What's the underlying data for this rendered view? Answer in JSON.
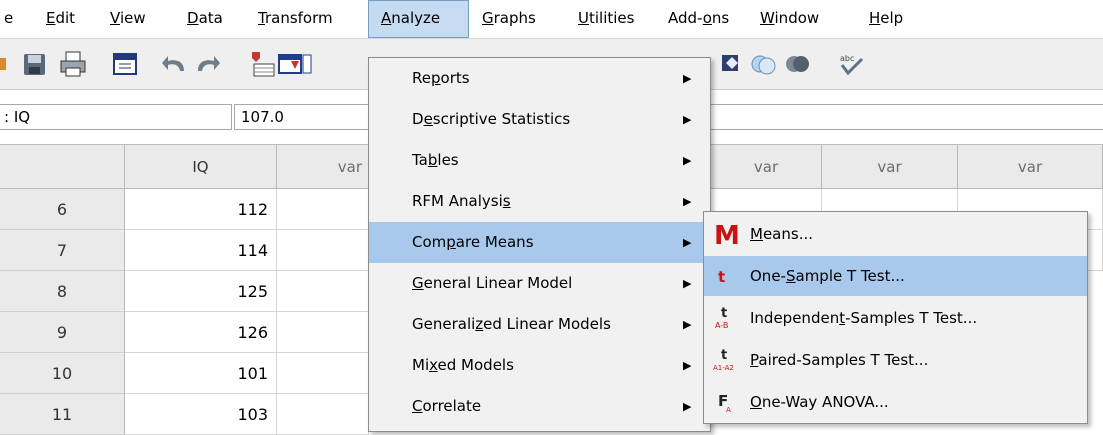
{
  "menubar": {
    "items": [
      {
        "id": "file",
        "pre": "",
        "ul": "",
        "post": "e"
      },
      {
        "id": "edit",
        "pre": "",
        "ul": "E",
        "post": "dit"
      },
      {
        "id": "view",
        "pre": "",
        "ul": "V",
        "post": "iew"
      },
      {
        "id": "data",
        "pre": "",
        "ul": "D",
        "post": "ata"
      },
      {
        "id": "transform",
        "pre": "",
        "ul": "T",
        "post": "ransform"
      },
      {
        "id": "analyze",
        "pre": "",
        "ul": "A",
        "post": "nalyze"
      },
      {
        "id": "graphs",
        "pre": "",
        "ul": "G",
        "post": "raphs"
      },
      {
        "id": "utilities",
        "pre": "",
        "ul": "U",
        "post": "tilities"
      },
      {
        "id": "addons",
        "pre": "Add-",
        "ul": "o",
        "post": "ns"
      },
      {
        "id": "window",
        "pre": "",
        "ul": "W",
        "post": "indow"
      },
      {
        "id": "help",
        "pre": "",
        "ul": "H",
        "post": "elp"
      }
    ]
  },
  "cellbar": {
    "cell_name": ": IQ",
    "cell_value": "107.0"
  },
  "grid": {
    "columns": [
      "IQ",
      "var",
      "var",
      "var",
      "var"
    ],
    "rows": [
      {
        "num": "6",
        "iq": "112"
      },
      {
        "num": "7",
        "iq": "114"
      },
      {
        "num": "8",
        "iq": "125"
      },
      {
        "num": "9",
        "iq": "126"
      },
      {
        "num": "10",
        "iq": "101"
      },
      {
        "num": "11",
        "iq": "103"
      }
    ]
  },
  "analyze_menu": {
    "items": [
      {
        "pre": "Re",
        "ul": "p",
        "post": "orts"
      },
      {
        "pre": "D",
        "ul": "e",
        "post": "scriptive Statistics"
      },
      {
        "pre": "Ta",
        "ul": "b",
        "post": "les"
      },
      {
        "pre": "RFM Analysi",
        "ul": "s",
        "post": ""
      },
      {
        "pre": "Com",
        "ul": "p",
        "post": "are Means"
      },
      {
        "pre": "",
        "ul": "G",
        "post": "eneral Linear Model"
      },
      {
        "pre": "Generali",
        "ul": "z",
        "post": "ed Linear Models"
      },
      {
        "pre": "Mi",
        "ul": "x",
        "post": "ed Models"
      },
      {
        "pre": "",
        "ul": "C",
        "post": "orrelate"
      }
    ],
    "highlighted_index": 4
  },
  "compare_means_submenu": {
    "items": [
      {
        "pre": "",
        "ul": "M",
        "post": "eans...",
        "icon": "means-icon"
      },
      {
        "pre": "One-",
        "ul": "S",
        "post": "ample T Test...",
        "icon": "one-sample-t-icon"
      },
      {
        "pre": "Independen",
        "ul": "t",
        "post": "-Samples T Test...",
        "icon": "independent-t-icon"
      },
      {
        "pre": "",
        "ul": "P",
        "post": "aired-Samples T Test...",
        "icon": "paired-t-icon"
      },
      {
        "pre": "",
        "ul": "O",
        "post": "ne-Way ANOVA...",
        "icon": "anova-icon"
      }
    ],
    "highlighted_index": 1
  },
  "colors": {
    "accent_highlight": "#a9c9ec",
    "means_icon_red": "#cc1111"
  }
}
